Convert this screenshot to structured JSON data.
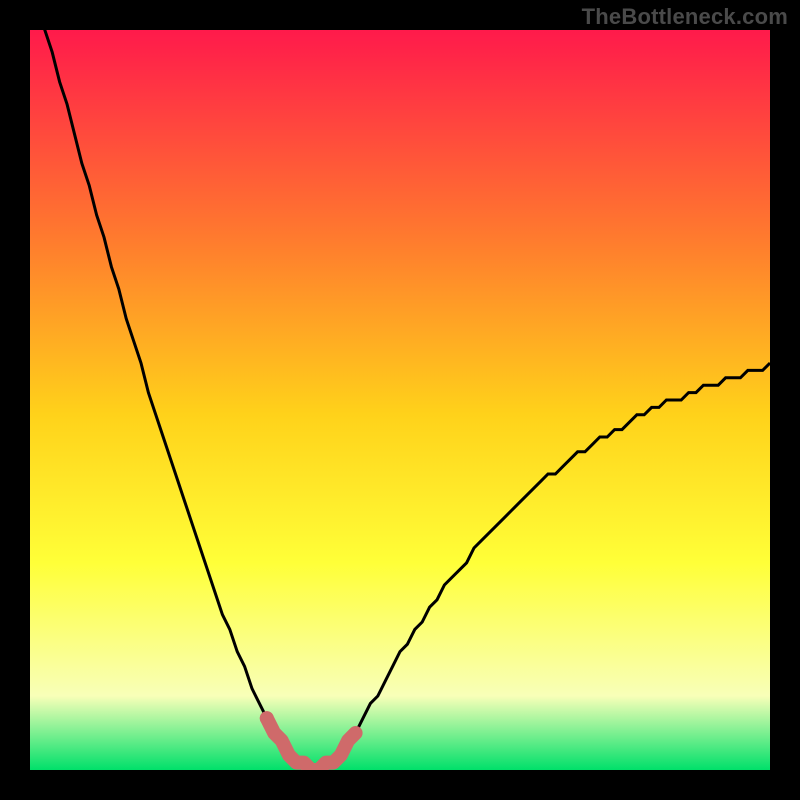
{
  "watermark": "TheBottleneck.com",
  "colors": {
    "background": "#000000",
    "gradient_top": "#ff1a4b",
    "gradient_mid_upper": "#ff7a2e",
    "gradient_mid": "#ffd21a",
    "gradient_mid_lower": "#ffff38",
    "gradient_lower": "#f8ffb8",
    "gradient_bottom": "#00e06a",
    "curve": "#000000",
    "highlight": "#cf6a6a"
  },
  "chart_data": {
    "type": "line",
    "title": "",
    "xlabel": "",
    "ylabel": "",
    "x": [
      0,
      1,
      2,
      3,
      4,
      5,
      6,
      7,
      8,
      9,
      10,
      11,
      12,
      13,
      14,
      15,
      16,
      17,
      18,
      19,
      20,
      21,
      22,
      23,
      24,
      25,
      26,
      27,
      28,
      29,
      30,
      31,
      32,
      33,
      34,
      35,
      36,
      37,
      38,
      39,
      40,
      41,
      42,
      43,
      44,
      45,
      46,
      47,
      48,
      49,
      50,
      51,
      52,
      53,
      54,
      55,
      56,
      57,
      58,
      59,
      60,
      61,
      62,
      63,
      64,
      65,
      66,
      67,
      68,
      69,
      70,
      71,
      72,
      73,
      74,
      75,
      76,
      77,
      78,
      79,
      80,
      81,
      82,
      83,
      84,
      85,
      86,
      87,
      88,
      89,
      90,
      91,
      92,
      93,
      94,
      95,
      96,
      97,
      98,
      99,
      100
    ],
    "values": [
      108,
      104,
      100,
      97,
      93,
      90,
      86,
      82,
      79,
      75,
      72,
      68,
      65,
      61,
      58,
      55,
      51,
      48,
      45,
      42,
      39,
      36,
      33,
      30,
      27,
      24,
      21,
      19,
      16,
      14,
      11,
      9,
      7,
      5,
      4,
      2,
      1,
      1,
      0,
      0,
      1,
      1,
      2,
      4,
      5,
      7,
      9,
      10,
      12,
      14,
      16,
      17,
      19,
      20,
      22,
      23,
      25,
      26,
      27,
      28,
      30,
      31,
      32,
      33,
      34,
      35,
      36,
      37,
      38,
      39,
      40,
      40,
      41,
      42,
      43,
      43,
      44,
      45,
      45,
      46,
      46,
      47,
      48,
      48,
      49,
      49,
      50,
      50,
      50,
      51,
      51,
      52,
      52,
      52,
      53,
      53,
      53,
      54,
      54,
      54,
      55
    ],
    "xlim": [
      0,
      100
    ],
    "ylim": [
      0,
      100
    ],
    "highlight_points_x": [
      32,
      33,
      34,
      35,
      36,
      37,
      38,
      39,
      40,
      41,
      42,
      43,
      44
    ],
    "highlight_points_y": [
      7,
      5,
      4,
      2,
      1,
      1,
      0,
      0,
      1,
      1,
      2,
      4,
      5
    ],
    "highlight_dot": {
      "x": 32,
      "y": 7
    }
  }
}
